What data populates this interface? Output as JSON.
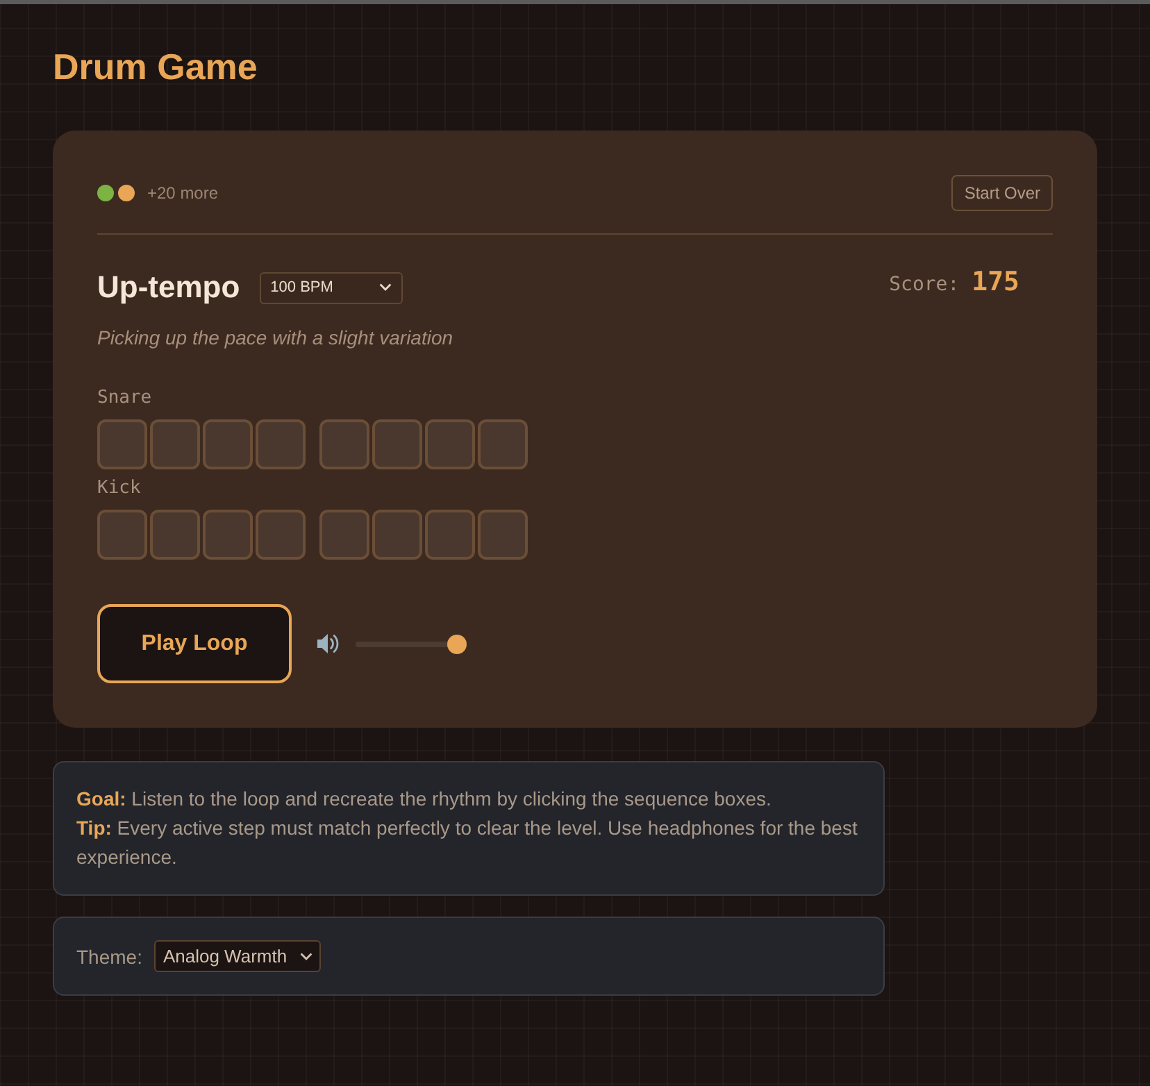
{
  "title": "Drum Game",
  "game": {
    "players": [
      {
        "color": "#7cb342"
      },
      {
        "color": "#e8a656"
      }
    ],
    "more_players": "+20 more",
    "start_over_button": "Start Over",
    "level": {
      "name": "Up-tempo",
      "tempo_select": "100 BPM",
      "description": "Picking up the pace with a slight variation"
    },
    "score": {
      "label": "Score:",
      "value": "175"
    },
    "tracks": [
      {
        "name": "Snare",
        "steps": [
          {
            "active": false
          },
          {
            "active": false
          },
          {
            "active": false
          },
          {
            "active": false
          },
          {
            "active": false
          },
          {
            "active": false
          },
          {
            "active": false
          },
          {
            "active": false
          }
        ]
      },
      {
        "name": "Kick",
        "steps": [
          {
            "active": false
          },
          {
            "active": false
          },
          {
            "active": false
          },
          {
            "active": false
          },
          {
            "active": false
          },
          {
            "active": false
          },
          {
            "active": false
          },
          {
            "active": false
          }
        ]
      }
    ],
    "play_button": "Play Loop",
    "volume": {
      "level": 1
    }
  },
  "info": {
    "lines": [
      "**Goal:** Listen to the loop and recreate the rhythm by clicking the sequence boxes.",
      "**Tip:** Every active step must match perfectly to clear the level. Use headphones for the best experience."
    ]
  },
  "settings": {
    "theme_label": "Theme:",
    "theme_select": "Analog Warmth"
  }
}
